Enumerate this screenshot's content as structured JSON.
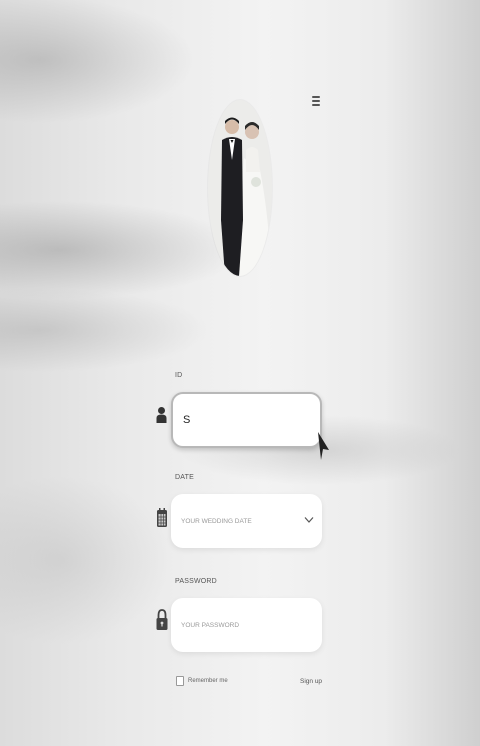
{
  "header": {
    "menu_icon": "menu-icon"
  },
  "profile": {
    "avatar": "couple-photo"
  },
  "form": {
    "id": {
      "label": "ID",
      "value": "S",
      "icon": "user-icon"
    },
    "date": {
      "label": "DATE",
      "placeholder": "YOUR WEDDING DATE",
      "icon": "calendar-icon"
    },
    "password": {
      "label": "PASSWORD",
      "placeholder": "YOUR PASSWORD",
      "icon": "lock-icon"
    },
    "remember_label": "Remember me",
    "signup_label": "Sign up"
  },
  "colors": {
    "field_bg": "#ffffff",
    "icon": "#444444",
    "border_active": "#b8b8b8"
  }
}
